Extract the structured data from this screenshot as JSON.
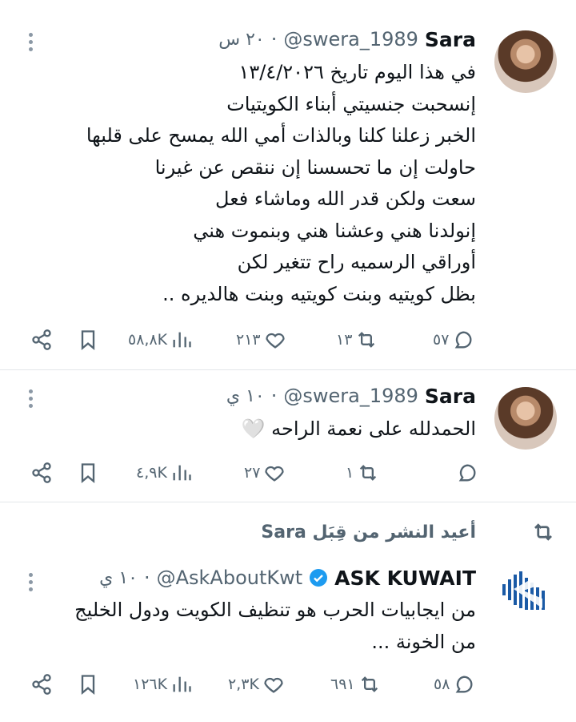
{
  "tweets": [
    {
      "name": "Sara",
      "handle": "@swera_1989",
      "time": "٢٠ س",
      "lines": [
        "في هذا اليوم تاريخ ١٣/٤/٢٠٢٦",
        "إنسحبت جنسيتي أبناء الكويتيات",
        "الخبر زعلنا كلنا وبالذات أمي الله يمسح على قلبها",
        "حاولت إن ما تحسسنا إن ننقص عن غيرنا",
        "سعت ولكن قدر الله وماشاء فعل",
        "إنولدنا هني وعشنا هني وبنموت هني",
        "أوراقي الرسميه راح تتغير لكن",
        "بظل كويتيه وبنت كويتيه وبنت هالديره .."
      ],
      "replies": "٥٧",
      "retweets": "١٣",
      "likes": "٢١٣",
      "views": "٥٨,٨K"
    },
    {
      "name": "Sara",
      "handle": "@swera_1989",
      "time": "١٠ ي",
      "lines": [
        "الحمدلله على نعمة الراحه 🤍"
      ],
      "replies": "",
      "retweets": "١",
      "likes": "٢٧",
      "views": "٤,٩K"
    },
    {
      "retweet_label": "أعيد النشر من قِبَل Sara",
      "name": "ASK KUWAIT",
      "handle": "@AskAboutKwt",
      "time": "١٠ ي",
      "lines": [
        "من ايجابيات الحرب هو تنظيف الكويت ودول الخليج",
        "من الخونة ..."
      ],
      "replies": "٥٨",
      "retweets": "٦٩١",
      "likes": "٢,٣K",
      "views": "١٢٦K"
    }
  ],
  "colors": {
    "text": "#0f1419",
    "muted": "#536471",
    "verified": "#1d9bf0",
    "divider": "#e3e6ea"
  }
}
